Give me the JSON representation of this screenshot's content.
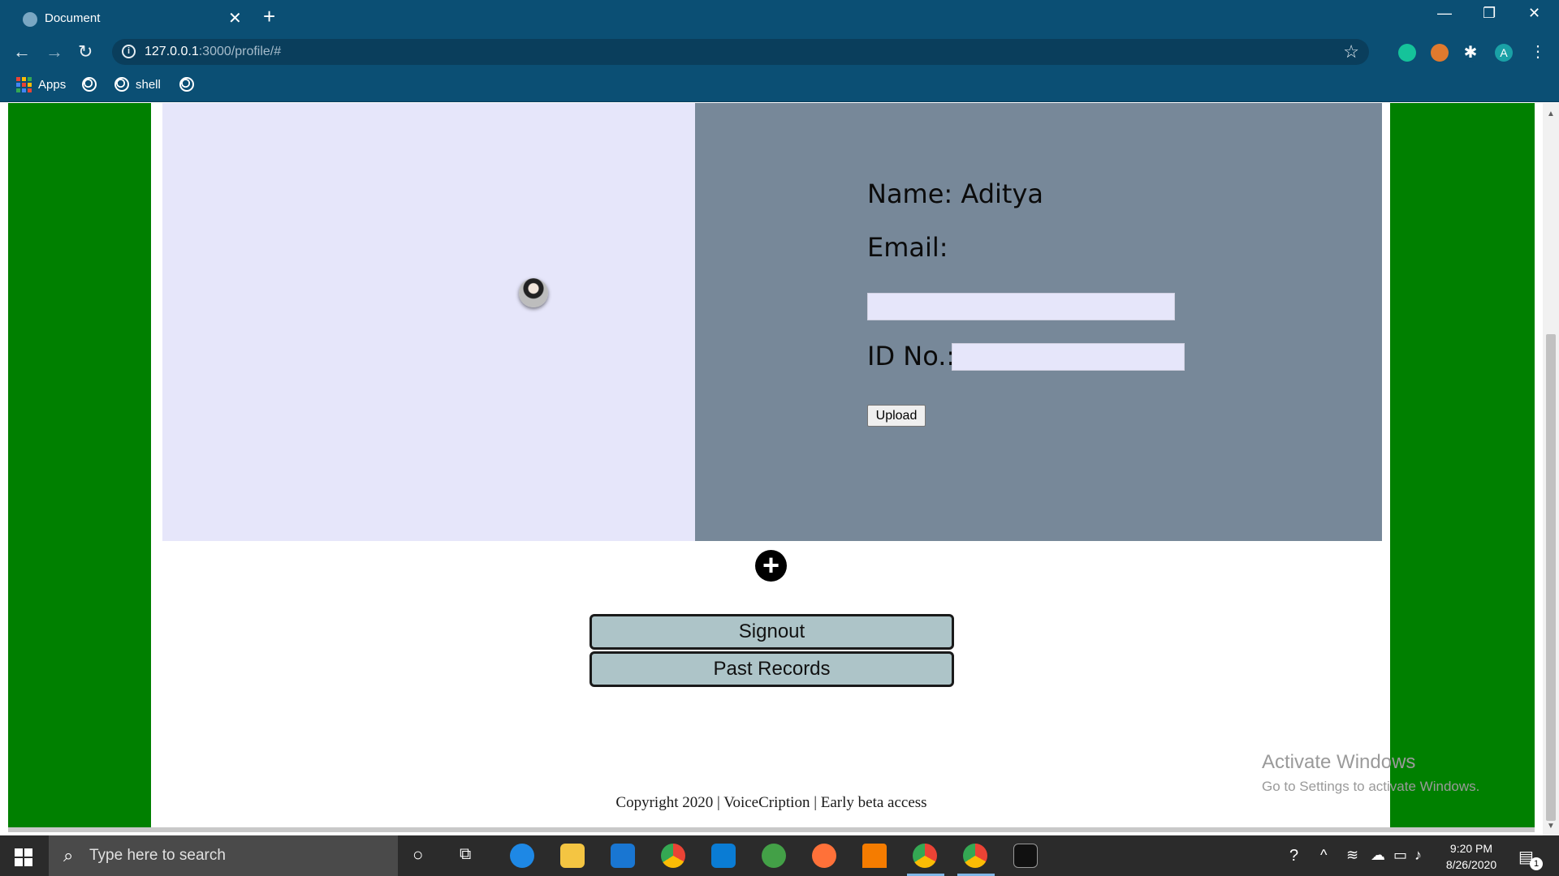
{
  "browser": {
    "tab_title": "Document",
    "url_host": "127.0.0.1",
    "url_path": ":3000/profile/#",
    "bookmarks": [
      "Apps",
      "shell"
    ],
    "profile_initial": "A"
  },
  "profile": {
    "name_label": "Name: Aditya",
    "email_label": "Email:",
    "id_label": "ID No.:",
    "email_value": "",
    "id_value": "",
    "upload_label": "Upload",
    "plus_symbol": "+"
  },
  "actions": {
    "signout_label": "Signout",
    "past_records_label": "Past Records"
  },
  "footer": {
    "copyright": "Copyright 2020 | VoiceCription | Early beta access"
  },
  "watermark": {
    "title": "Activate Windows",
    "subtitle": "Go to Settings to activate Windows."
  },
  "taskbar": {
    "search_placeholder": "Type here to search",
    "time": "9:20 PM",
    "date": "8/26/2020",
    "notification_count": "1"
  },
  "colors": {
    "chrome": "#0b4f74",
    "side_green": "#008000",
    "panel_left": "#e6e6fa",
    "panel_right": "#778899",
    "button_bg": "#adc4c8"
  }
}
